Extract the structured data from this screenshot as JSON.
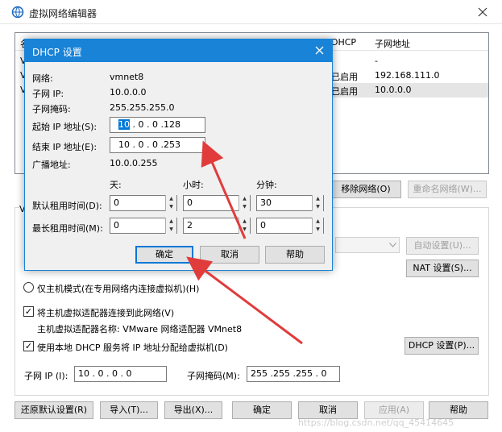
{
  "window": {
    "title": "虚拟网络编辑器"
  },
  "list": {
    "headers": {
      "col1": "名",
      "dhcp": "DHCP",
      "subnet": "子网地址"
    },
    "row_stubs": [
      "V",
      "V",
      "V"
    ],
    "rows": [
      {
        "dhcp": "",
        "subnet": "-"
      },
      {
        "dhcp": "已启用",
        "subnet": "192.168.111.0"
      },
      {
        "dhcp": "已启用",
        "subnet": "10.0.0.0"
      }
    ]
  },
  "main_buttons": {
    "remove_network": "移除网络(O)",
    "rename_network": "重命名网络(W)..."
  },
  "settings": {
    "group_stub": "V",
    "auto_setting": "自动设置(U)...",
    "nat_setting": "NAT 设置(S)...",
    "host_only": "仅主机模式(在专用网络内连接虚拟机)(H)",
    "connect_adapter": "将主机虚拟适配器连接到此网络(V)",
    "adapter_name": "主机虚拟适配器名称: VMware 网络适配器 VMnet8",
    "use_dhcp": "使用本地 DHCP 服务将 IP 地址分配给虚拟机(D)",
    "dhcp_setting": "DHCP 设置(P)...",
    "subnet_ip_label": "子网 IP (I):",
    "subnet_ip": "10 . 0 . 0 . 0",
    "subnet_mask_label": "子网掩码(M):",
    "subnet_mask": "255 .255 .255 . 0"
  },
  "bottom_buttons": {
    "restore": "还原默认设置(R)",
    "import": "导入(T)...",
    "export": "导出(X)...",
    "ok": "确定",
    "cancel": "取消",
    "apply": "应用(A)",
    "help": "帮助"
  },
  "dhcp_dialog": {
    "title": "DHCP 设置",
    "network_label": "网络:",
    "network_value": "vmnet8",
    "subnet_ip_label": "子网 IP:",
    "subnet_ip_value": "10.0.0.0",
    "subnet_mask_label": "子网掩码:",
    "subnet_mask_value": "255.255.255.0",
    "start_ip_label": "起始 IP 地址(S):",
    "start_ip_first": "10",
    "start_ip_rest": " .  0  .  0  .128",
    "end_ip_label": "结束 IP 地址(E):",
    "end_ip_value": "10  .  0  .  0  .253",
    "broadcast_label": "广播地址:",
    "broadcast_value": "10.0.0.255",
    "col_days": "天:",
    "col_hours": "小时:",
    "col_minutes": "分钟:",
    "default_lease_label": "默认租用时间(D):",
    "default_lease": {
      "days": "0",
      "hours": "0",
      "minutes": "30"
    },
    "max_lease_label": "最长租用时间(M):",
    "max_lease": {
      "days": "0",
      "hours": "2",
      "minutes": "0"
    },
    "ok": "确定",
    "cancel": "取消",
    "help": "帮助"
  },
  "watermark": "https://blog.csdn.net/qq_45414645",
  "colors": {
    "accent": "#1883d7",
    "arrow": "#e03c3c"
  }
}
